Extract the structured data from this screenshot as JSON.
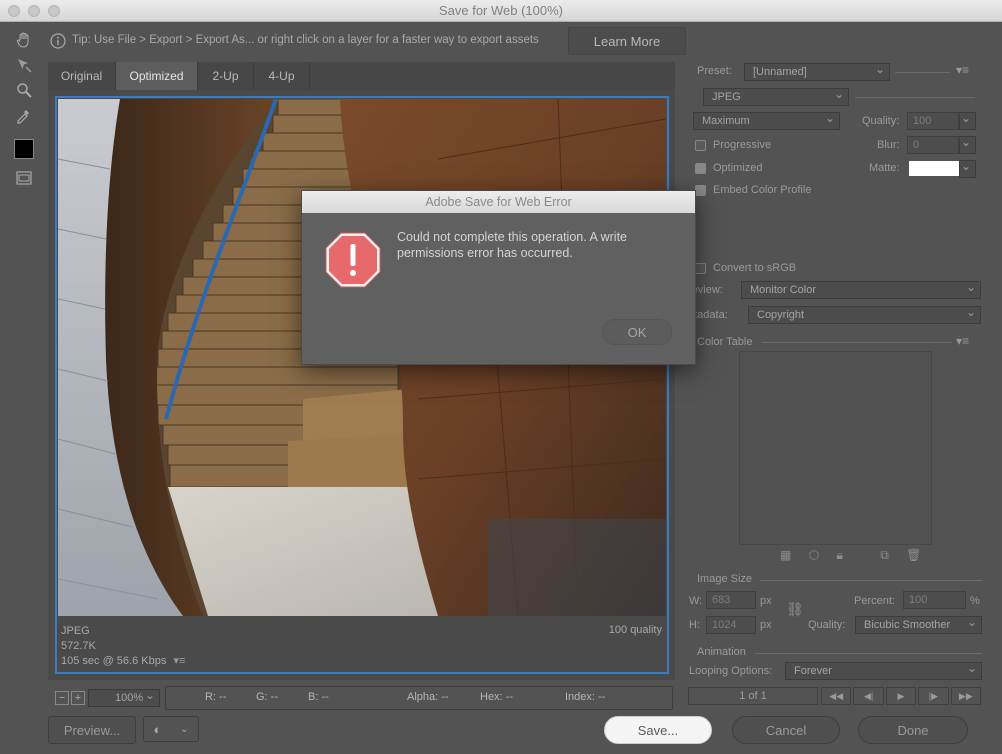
{
  "window": {
    "title": "Save for Web (100%)"
  },
  "tip": {
    "text": "Tip: Use File > Export > Export As...  or right click on a layer for a faster way to export assets",
    "learn_more": "Learn More"
  },
  "tabs": [
    "Original",
    "Optimized",
    "2-Up",
    "4-Up"
  ],
  "image_info": {
    "format": "JPEG",
    "size": "572.7K",
    "time": "105 sec @ 56.6 Kbps",
    "quality": "100 quality"
  },
  "status": {
    "zoom": "100%",
    "r": "R: --",
    "g": "G: --",
    "b": "B: --",
    "alpha": "Alpha: --",
    "hex": "Hex: --",
    "index": "Index: --"
  },
  "buttons": {
    "preview": "Preview...",
    "save": "Save...",
    "cancel": "Cancel",
    "done": "Done"
  },
  "settings": {
    "preset_label": "Preset:",
    "preset_value": "[Unnamed]",
    "format_value": "JPEG",
    "compression_value": "Maximum",
    "quality_label": "Quality:",
    "quality_value": "100",
    "progressive_label": "Progressive",
    "blur_label": "Blur:",
    "blur_value": "0",
    "optimized_label": "Optimized",
    "matte_label": "Matte:",
    "embed_label": "Embed Color Profile",
    "convert_label": "Convert to sRGB",
    "preview_label": "review:",
    "preview_value": "Monitor Color",
    "metadata_label": "etadata:",
    "metadata_value": "Copyright",
    "color_table_label": "Color Table"
  },
  "image_size": {
    "title": "Image Size",
    "w_label": "W:",
    "w_value": "683",
    "h_label": "H:",
    "h_value": "1024",
    "unit": "px",
    "percent_label": "Percent:",
    "percent_value": "100",
    "percent_unit": "%",
    "quality_label": "Quality:",
    "quality_value": "Bicubic Smoother"
  },
  "animation": {
    "title": "Animation",
    "looping_label": "Looping Options:",
    "looping_value": "Forever",
    "frame_counter": "1 of 1"
  },
  "dialog": {
    "title": "Adobe Save for Web Error",
    "message": "Could not complete this operation. A write permissions error has occurred.",
    "ok": "OK"
  },
  "colors": {
    "selection_border": "#3d7bbf",
    "error_icon": "#e8696b",
    "panel_bg": "#535353"
  }
}
